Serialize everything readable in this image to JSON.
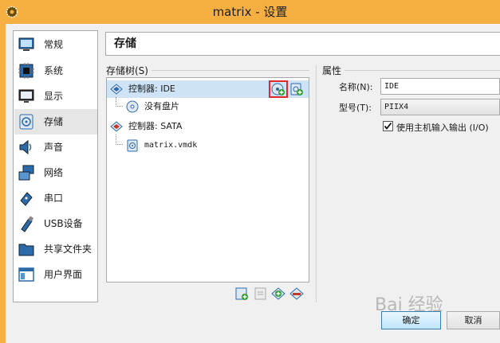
{
  "window": {
    "title": "matrix - 设置"
  },
  "sidebar": {
    "items": [
      {
        "label": "常规",
        "icon": "monitor-icon"
      },
      {
        "label": "系统",
        "icon": "chip-icon"
      },
      {
        "label": "显示",
        "icon": "display-icon"
      },
      {
        "label": "存储",
        "icon": "storage-icon",
        "selected": true
      },
      {
        "label": "声音",
        "icon": "speaker-icon"
      },
      {
        "label": "网络",
        "icon": "network-icon"
      },
      {
        "label": "串口",
        "icon": "serial-port-icon"
      },
      {
        "label": "USB设备",
        "icon": "usb-icon"
      },
      {
        "label": "共享文件夹",
        "icon": "folder-icon"
      },
      {
        "label": "用户界面",
        "icon": "window-icon"
      }
    ]
  },
  "page": {
    "title": "存储"
  },
  "storage_tree": {
    "title": "存储树(S)",
    "nodes": [
      {
        "label": "控制器: IDE",
        "type": "controller",
        "selected": true
      },
      {
        "label": "没有盘片",
        "type": "optical"
      },
      {
        "label": "控制器: SATA",
        "type": "controller"
      },
      {
        "label": "matrix.vmdk",
        "type": "disk"
      }
    ]
  },
  "attributes": {
    "title": "属性",
    "name_label": "名称(N):",
    "name_value": "IDE",
    "type_label": "型号(T):",
    "type_value": "PIIX4",
    "host_io_cache_label": "使用主机输入输出 (I/O)",
    "host_io_cache_checked": true
  },
  "buttons": {
    "ok": "确定",
    "cancel": "取消"
  },
  "watermark": {
    "text": "Bai 经验"
  },
  "colors": {
    "titlebar": "#f6b041",
    "selection": "#cfe3f7",
    "highlight_box": "#e0282e"
  }
}
